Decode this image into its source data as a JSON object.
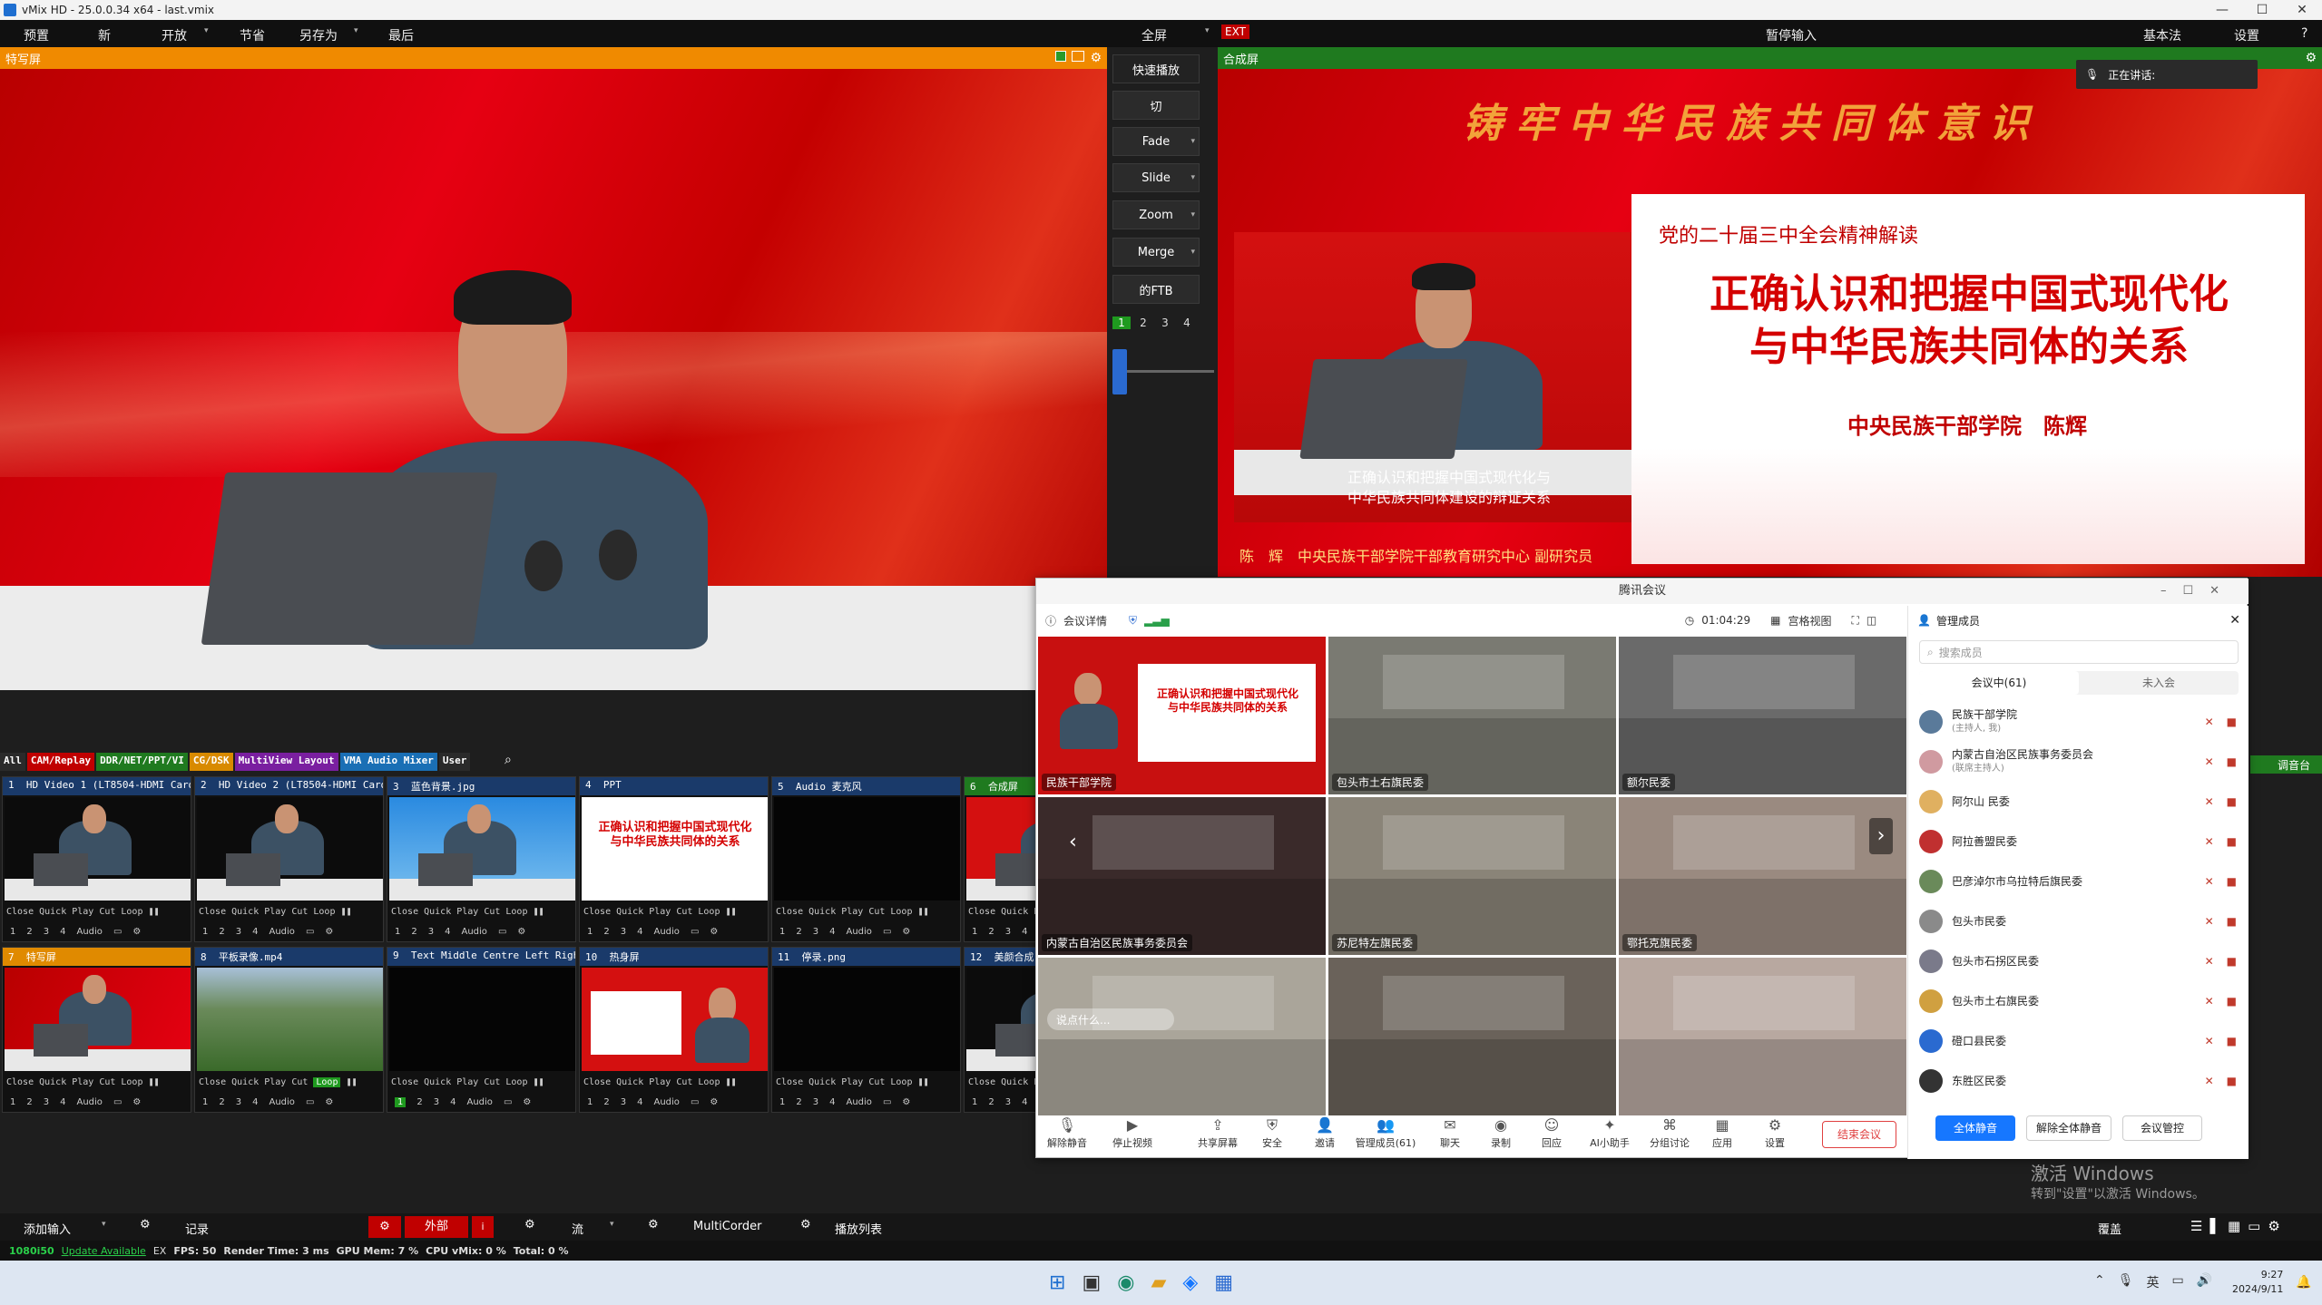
{
  "titlebar": {
    "title": "vMix HD - 25.0.0.34 x64 - last.vmix",
    "min": "—",
    "max": "☐",
    "close": "✕"
  },
  "menu": {
    "preview": "预置",
    "new": "新",
    "open": "开放",
    "save": "节省",
    "save_as": "另存为",
    "last": "最后",
    "fullscreen": "全屏",
    "ext": "EXT",
    "pause_input": "暂停输入",
    "basic": "基本法",
    "settings": "设置",
    "help": "?"
  },
  "preview_panel": {
    "label": "特写屏"
  },
  "output_panel": {
    "label": "合成屏",
    "talking": "正在讲话:"
  },
  "transitions": {
    "quick_play": "快速播放",
    "cut": "切",
    "fade": "Fade",
    "slide": "Slide",
    "zoom": "Zoom",
    "merge": "Merge",
    "ftb": "的FTB",
    "pages": [
      "1",
      "2",
      "3",
      "4"
    ]
  },
  "slide": {
    "banner": "铸牢中华民族共同体意识",
    "subtitle": "党的二十届三中全会精神解读",
    "title_line1": "正确认识和把握中国式现代化",
    "title_line2": "与中华民族共同体的关系",
    "author": "中央民族干部学院　陈辉",
    "caption_line1": "正确认识和把握中国式现代化与",
    "caption_line2": "中华民族共同体建设的辩证关系",
    "lower_third": "陈　辉　中央民族干部学院干部教育研究中心 副研究员"
  },
  "input_tabs": [
    {
      "label": "All",
      "color": "#2a2a2a"
    },
    {
      "label": "CAM/Replay",
      "color": "#c00000"
    },
    {
      "label": "DDR/NET/PPT/VI",
      "color": "#1f7a1f"
    },
    {
      "label": "CG/DSK",
      "color": "#d88a00"
    },
    {
      "label": "MultiView Layout",
      "color": "#7a1fa0"
    },
    {
      "label": "VMA Audio Mixer",
      "color": "#1a6fb5"
    },
    {
      "label": "User",
      "color": "#2a2a2a"
    }
  ],
  "inputs": [
    {
      "num": "1",
      "name": "HD Video 1 (LT8504-HDMI Card)",
      "color": "#1a3a6a",
      "thumb": "cam",
      "loop": "Loop"
    },
    {
      "num": "2",
      "name": "HD Video 2 (LT8504-HDMI Card)",
      "color": "#1a3a6a",
      "thumb": "cam",
      "loop": "Loop"
    },
    {
      "num": "3",
      "name": "蓝色背景.jpg",
      "color": "#1a3a6a",
      "thumb": "blue",
      "loop": "Loop"
    },
    {
      "num": "4",
      "name": "PPT",
      "color": "#1a3a6a",
      "thumb": "ppt",
      "loop": "Loop"
    },
    {
      "num": "5",
      "name": "Audio 麦克风",
      "color": "#1a3a6a",
      "thumb": "black",
      "loop": "Loop"
    },
    {
      "num": "6",
      "name": "合成屏",
      "color": "#1f7a1f",
      "thumb": "red",
      "loop": "Loop"
    },
    {
      "num": "7",
      "name": "特写屏",
      "color": "#e08a00",
      "thumb": "redcam",
      "loop": "Loop"
    },
    {
      "num": "8",
      "name": "平板录像.mp4",
      "color": "#1a3a6a",
      "thumb": "green",
      "loop": "Loop"
    },
    {
      "num": "9",
      "name": "Text Middle Centre Left Right",
      "color": "#1a3a6a",
      "thumb": "black",
      "loop": "Loop"
    },
    {
      "num": "10",
      "name": "热身屏",
      "color": "#1a3a6a",
      "thumb": "redppt",
      "loop": "Loop"
    },
    {
      "num": "11",
      "name": "停录.png",
      "color": "#1a3a6a",
      "thumb": "black",
      "loop": "Loop"
    },
    {
      "num": "12",
      "name": "美颜合成",
      "color": "#1a3a6a",
      "thumb": "cam",
      "loop": "Loop"
    }
  ],
  "tile_controls": {
    "close": "Close",
    "quick_play": "Quick Play",
    "cut": "Cut",
    "audio": "Audio",
    "n1": "1",
    "n2": "2",
    "n3": "3",
    "n4": "4"
  },
  "bottombar": {
    "add_input": "添加输入",
    "record": "记录",
    "external": "外部",
    "stream": "流",
    "multicorder": "MultiCorder",
    "playlist": "播放列表",
    "overlay": "覆盖"
  },
  "statusbar": {
    "resolution": "1080i50",
    "update": "Update Available",
    "ex": "EX",
    "fps": "FPS: 50",
    "render": "Render Time: 3 ms",
    "gpu": "GPU Mem: 7 %",
    "cpu": "CPU vMix: 0 %",
    "total": "Total: 0 %"
  },
  "side_label": "调音台",
  "meeting": {
    "window_title": "腾讯会议",
    "info": "会议详情",
    "timer": "01:04:29",
    "view": "宫格视图",
    "manage": "管理成员",
    "search_placeholder": "搜索成员",
    "tab_in": "会议中(61)",
    "tab_not": "未入会",
    "cells": [
      {
        "label": "民族干部学院",
        "bg": "#c81010"
      },
      {
        "label": "包头市土右旗民委",
        "bg": "#7a7a72"
      },
      {
        "label": "额尔民委",
        "bg": "#6a6a6a"
      },
      {
        "label": "内蒙古自治区民族事务委员会",
        "bg": "#3a2a2a"
      },
      {
        "label": "苏尼特左旗民委",
        "bg": "#8a8478"
      },
      {
        "label": "鄂托克旗民委",
        "bg": "#9a8a80"
      },
      {
        "label": "",
        "bg": "#aaa59a"
      },
      {
        "label": "",
        "bg": "#6a625a"
      },
      {
        "label": "",
        "bg": "#b8a8a0"
      }
    ],
    "hint": "说点什么...",
    "members": [
      {
        "name": "民族干部学院",
        "sub": "(主持人, 我)",
        "color": "#5a7a9a"
      },
      {
        "name": "内蒙古自治区民族事务委员会",
        "sub": "(联席主持人)",
        "color": "#d09aa0"
      },
      {
        "name": "阿尔山 民委",
        "sub": "",
        "color": "#e0b060"
      },
      {
        "name": "阿拉善盟民委",
        "sub": "",
        "color": "#c03030"
      },
      {
        "name": "巴彦淖尔市乌拉特后旗民委",
        "sub": "",
        "color": "#6a8a5a"
      },
      {
        "name": "包头市民委",
        "sub": "",
        "color": "#8a8a8a"
      },
      {
        "name": "包头市石拐区民委",
        "sub": "",
        "color": "#7a7a8a"
      },
      {
        "name": "包头市土右旗民委",
        "sub": "",
        "color": "#d0a040"
      },
      {
        "name": "磴口县民委",
        "sub": "",
        "color": "#2a6ad0"
      },
      {
        "name": "东胜区民委",
        "sub": "",
        "color": "#333333"
      }
    ],
    "toolbar": {
      "mute": "解除静音",
      "video": "停止视频",
      "share": "共享屏幕",
      "security": "安全",
      "invite": "邀请",
      "members": "管理成员(61)",
      "chat": "聊天",
      "record": "录制",
      "react": "回应",
      "ai": "AI小助手",
      "breakout": "分组讨论",
      "apps": "应用",
      "settings": "设置",
      "end": "结束会议"
    },
    "mute_all": "全体静音",
    "unmute_all": "解除全体静音",
    "control": "会议管控"
  },
  "activation": {
    "line1": "激活 Windows",
    "line2": "转到\"设置\"以激活 Windows。"
  },
  "taskbar": {
    "time": "9:27",
    "date": "2024/9/11",
    "lang": "英"
  }
}
